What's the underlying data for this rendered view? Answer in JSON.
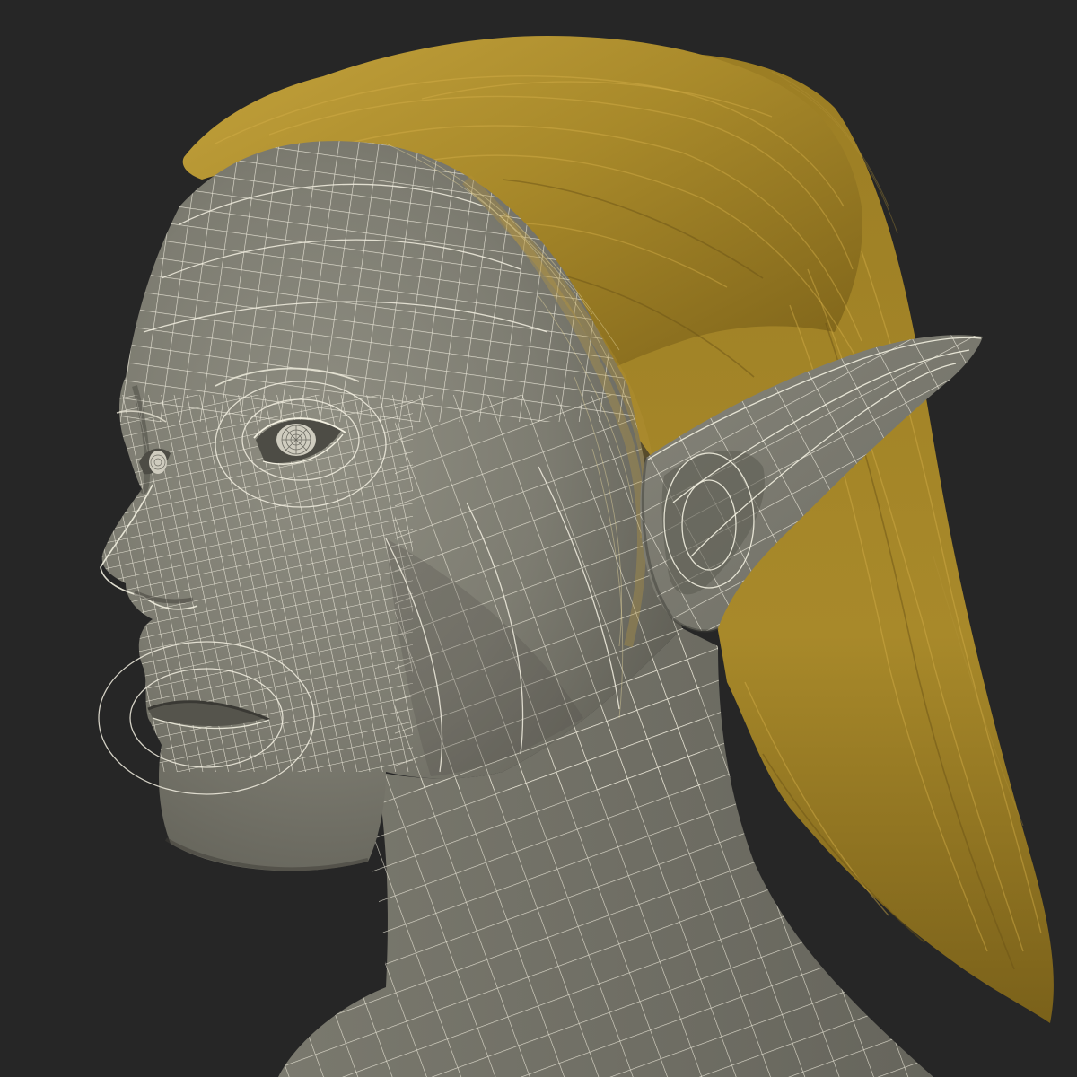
{
  "scene": {
    "kind": "3d-wireframe-render",
    "subject": "elf-head-bust",
    "view": "three-quarter-left",
    "colors": {
      "background": "#262626",
      "skin": "#807f73",
      "skin_shadow": "#5f5e55",
      "skin_highlight": "#9a998c",
      "wire": "#f2efe0",
      "hair": "#a8892a",
      "hair_light": "#c7a640",
      "hair_dark": "#6e5716",
      "eye": "#e6e4d8"
    },
    "icons": [
      "elf-head-model",
      "hair-mesh",
      "pointed-ear-mesh",
      "wireframe-overlay"
    ]
  }
}
